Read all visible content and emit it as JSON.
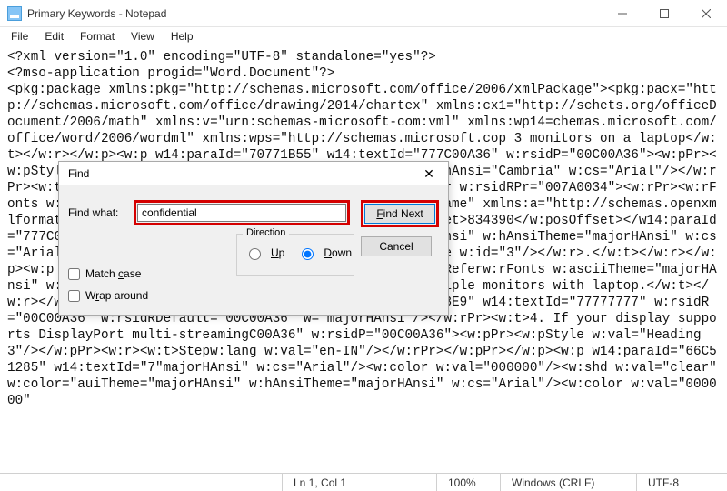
{
  "window": {
    "title": "Primary Keywords - Notepad"
  },
  "menu": {
    "file": "File",
    "edit": "Edit",
    "format": "Format",
    "view": "View",
    "help": "Help"
  },
  "editor": {
    "content": "<?xml version=\"1.0\" encoding=\"UTF-8\" standalone=\"yes\"?>\n<?mso-application progid=\"Word.Document\"?>\n<pkg:package xmlns:pkg=\"http://schemas.microsoft.com/office/2006/xmlPackage\"><pkg:pacx=\"http://schemas.microsoft.com/office/drawing/2014/chartex\" xmlns:cx1=\"http://schets.org/officeDocument/2006/math\" xmlns:v=\"urn:schemas-microsoft-com:vml\" xmlns:wp14=chemas.microsoft.com/office/word/2006/wordml\" xmlns:wps=\"http://schemas.microsoft.cop 3 monitors on a laptop</w:t></w:r></w:p><w:p w14:paraId=\"70771B55\" w14:textId=\"777C00A36\" w:rsidP=\"00C00A36\"><w:pPr><w:pStyle w:val=\"Heading1\"/><w:jc w:val=\"center\"/>ria\" w:hAnsi=\"Cambria\" w:cs=\"Arial\"/></w:rPr><w:t>Id=\"2\"/></w:r><w:commentRangeEhow</w:t></w:r><w:r w:rsidRPr=\"007A0034\"><w:rPr><w:rFonts w:asciiTheme=\"majorHAnsi\" w:hAnsiTheme=\"majorHAicFrame\" xmlns:a=\"http://schemas.openxmlformats.org/drawingml/2006/main\" noChangline><w:posOffset>834390</w:posOffset></w14:paraId=\"777C00A36\" w14:textId=\"4621A81C\" w:rsiciTheme=\"majorHAnsi\" w:hAnsiTheme=\"majorHAnsi\" w:cs=\"Arial\"/></w:rPr><w:t xml:space=\"preserve\"> </tReference w:id=\"3\"/></w:r>.</w:t></w:r></w:p><w:p w14:paraId=\"ria\"/></w:rPr></w:pPr><w:r><w:commentReferw:rFonts w:asciiTheme=\"majorHAnsi\" w:hAnsiTheme=\"majorHAnsi\"/></w:rPr></w:r><w:r w:ultiple monitors with laptop.</w:t></w:r></w:p><w:p w14:paraId=\"40E9FD8C\" w14:textIcId=\"76D4A8E9\" w14:textId=\"77777777\" w:rsidR=\"00C00A36\" w:rsidRDefault=\"00C00A36\" w=\"majorHAnsi\"/></w:rPr><w:t>4. If your display supports DisplayPort multi-streamingC00A36\" w:rsidP=\"00C00A36\"><w:pPr><w:pStyle w:val=\"Heading3\"/></w:pPr><w:r><w:t>Stepw:lang w:val=\"en-IN\"/></w:rPr></w:pPr></w:p><w:p w14:paraId=\"66C51285\" w14:textId=\"7\"majorHAnsi\" w:cs=\"Arial\"/><w:color w:val=\"000000\"/><w:shd w:val=\"clear\" w:color=\"auiTheme=\"majorHAnsi\" w:hAnsiTheme=\"majorHAnsi\" w:cs=\"Arial\"/><w:color w:val=\"000000\""
  },
  "find": {
    "title": "Find",
    "label": "Find what:",
    "value": "confidential",
    "direction_label": "Direction",
    "up": "Up",
    "down": "Down",
    "match_case": "Match case",
    "wrap_around": "Wrap around",
    "find_next": "Find Next",
    "cancel": "Cancel"
  },
  "status": {
    "pos": "Ln 1, Col 1",
    "zoom": "100%",
    "eol": "Windows (CRLF)",
    "encoding": "UTF-8"
  }
}
